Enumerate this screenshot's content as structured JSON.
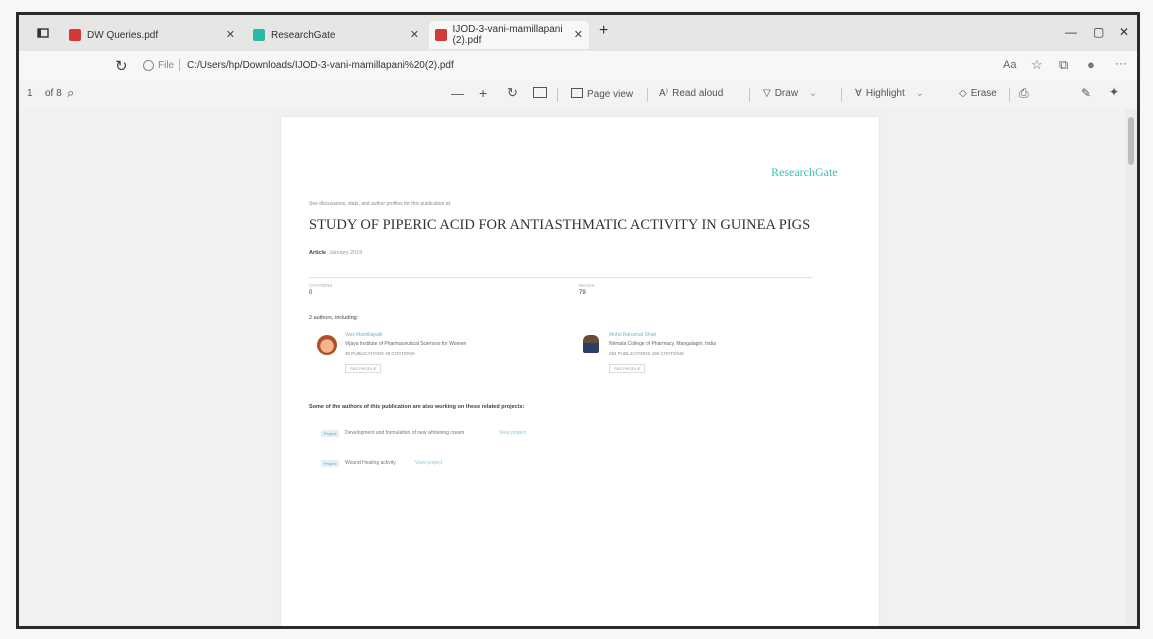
{
  "tabs": [
    {
      "label": "DW Queries.pdf",
      "icon": "pdf-icon"
    },
    {
      "label": "ResearchGate",
      "icon": "researchgate-icon"
    },
    {
      "label": "IJOD-3-vani-mamillapani (2).pdf",
      "icon": "pdf-icon"
    }
  ],
  "address": {
    "prefix": "File",
    "url": "C:/Users/hp/Downloads/IJOD-3-vani-mamillapani%20(2).pdf"
  },
  "pdf_toolbar": {
    "page_current": "1",
    "page_total": "of 8",
    "zoom_out": "—",
    "zoom_in": "+",
    "page_view": "Page view",
    "read_aloud": "Read aloud",
    "draw": "Draw",
    "highlight": "Highlight",
    "erase": "Erase"
  },
  "page": {
    "logo": "ResearchGate",
    "header_note": "See discussions, stats, and author profiles for this publication at:",
    "title": "STUDY OF PIPERIC ACID FOR ANTIASTHMATIC ACTIVITY IN GUINEA PIGS",
    "article_label": "Article",
    "article_date": "January 2019",
    "citations_label": "CITATIONS",
    "citations_value": "0",
    "reads_label": "READS",
    "reads_value": "79",
    "authors_heading": "2 authors, including:",
    "author1_name": "Vani Mamillapalli",
    "author1_affil": "Vijaya Institute of Pharmaceutical Sciences for Women",
    "author1_stats": "36 PUBLICATIONS 28 CITATIONS",
    "author1_button": "SEE PROFILE",
    "author2_name": "Mohd Rahamat Shah",
    "author2_affil": "Nirmala College of Pharmacy, Mangalagiri, India",
    "author2_stats": "284 PUBLICATIONS 186 CITATIONS",
    "author2_button": "SEE PROFILE",
    "related_heading": "Some of the authors of this publication are also working on these related projects:",
    "project_tag": "Project",
    "project1": "Development and formulation of new whitening cream",
    "project1_link": "View project",
    "project2": "Wound Healing activity",
    "project2_link": "View project"
  }
}
